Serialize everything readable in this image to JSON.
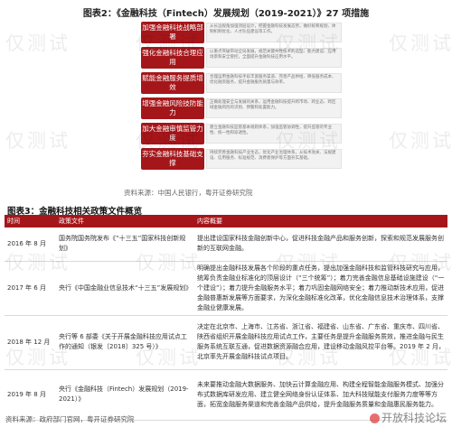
{
  "figure2": {
    "title": "图表2：《金融科技（Fintech）发展规划（2019-2021）》27 项措施",
    "source": "资料来源：中国人民银行，粤开证券研究院",
    "measures": [
      {
        "label": "加强金融科技战略部署",
        "detail": "从长远视角加强顶层设计，把握金融科技发展态势，做好统筹规划、体制机制优化、人才队伍建设等工作。"
      },
      {
        "label": "强化金融科技合理应用",
        "detail": "以重点突破带动全局发展，规范关键共性技术的选型、能力建设、应用场景和安全管控，全面提升金融科技应用水平。"
      },
      {
        "label": "赋能金融服务提质增效",
        "detail": "合理运用金融科技手段丰富服务渠道、完善产品供给、降低服务成本、优化融资服务，提升金融服务质量与效率。"
      },
      {
        "label": "增强金融风险技防能力",
        "detail": "正确处理安全与发展的关系，运用金融科技提升跨市场、跨业态、跨区域金融风险的识别、预警和处置能力。"
      },
      {
        "label": "加大金融审慎监管力度",
        "detail": "建立金融科技监管基本规则体系，加强监管协调性，提升监管的专业性、统一性和穿透性。"
      },
      {
        "label": "夯实金融科技基础支撑",
        "detail": "持续完善金融科技产业生态，优化产业治理体系，从技术攻关、法规建设、信用服务、标准规范、消费者保护等方面夯实基础。"
      }
    ]
  },
  "figure3": {
    "title": "图表3：金融科技相关政策文件概览",
    "columns": [
      "时间",
      "政策文件",
      "内容概要"
    ],
    "rows": [
      {
        "time": "2016 年 8 月",
        "doc": "国务院国务院发布《“十三五”国家科技创新规划》",
        "summary": "提出建设国家科技金融创新中心，促进科技金融产品和服务创新，探索和规范发展服务创新的互联网金融。"
      },
      {
        "time": "2017 年 6 月",
        "doc": "央行《中国金融业信息技术“十三五”发展规划》",
        "summary": "明确提出金融科技发展各个阶段的重点任务，提出加强金融科技和监管科技研究与应用，统筹负责金融业标准化的顶层设计（“三个统筹”）；着力完善金融信息基础设施建设（“一个建设”）；着力提升金融服务水平；着力巩固金融网络安全；着力推动新技术应用，促进金融普惠新发展等方面要求，为深化金融标准化改革，优化金融信息技术治理体系，支撑金融业健康发展。"
      },
      {
        "time": "2018 年 12 月",
        "doc": "央行等 6 部委《关于开展金融科技应用试点工作的通知（银发〔2018〕325 号）》",
        "summary": "决定在北京市、上海市、江苏省、浙江省、福建省、山东省、广东省、重庆市、四川省、陕西省组织开展金融科技应用试点工作，主要任务是提升金融服务质效，推进金融与民生服务系统互联互通，促进数据资源融合应用，建设移动金融风控平台等。2019 年 2 月，北京率先开展金融科技试点项目。"
      },
      {
        "time": "2019 年 8 月",
        "doc": "央行《金融科技（Fintech）发展规划（2019-2021）》",
        "summary": "未来要推动金融大数据服务、加快云计算金融应用、构建全程智能金融服务模式、加强分布式数据库研发应用、建立健全网络身份认证体系、加大科技赋能支付服务力度等等方面，拓宽金融服务渠道和完善金融产品供给，提升金融服务质量和金融惠民服务能力。"
      }
    ],
    "source": "资料来源：政府部门官网，粤开证券研究院"
  },
  "watermark": {
    "text": "仅测试",
    "brand": "开放科技论坛"
  }
}
